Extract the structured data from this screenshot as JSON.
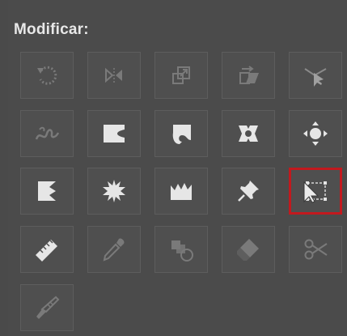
{
  "panel": {
    "title": "Modificar:",
    "selected_tool": "path-selection-tool",
    "accent_color": "#c2191e"
  },
  "tools": [
    {
      "row": 1,
      "col": 1,
      "icon": "rotate-icon"
    },
    {
      "row": 1,
      "col": 2,
      "icon": "reflect-icon"
    },
    {
      "row": 1,
      "col": 3,
      "icon": "scale-icon"
    },
    {
      "row": 1,
      "col": 4,
      "icon": "shear-icon"
    },
    {
      "row": 1,
      "col": 5,
      "icon": "reshape-icon"
    },
    {
      "row": 2,
      "col": 1,
      "icon": "warp-icon"
    },
    {
      "row": 2,
      "col": 2,
      "icon": "pucker-icon"
    },
    {
      "row": 2,
      "col": 3,
      "icon": "twirl-icon"
    },
    {
      "row": 2,
      "col": 4,
      "icon": "scallop-icon"
    },
    {
      "row": 2,
      "col": 5,
      "icon": "bloat-icon"
    },
    {
      "row": 3,
      "col": 1,
      "icon": "crystallize-icon"
    },
    {
      "row": 3,
      "col": 2,
      "icon": "explode-icon"
    },
    {
      "row": 3,
      "col": 3,
      "icon": "wrinkle-icon"
    },
    {
      "row": 3,
      "col": 4,
      "icon": "pin-icon"
    },
    {
      "row": 3,
      "col": 5,
      "icon": "free-transform-icon"
    },
    {
      "row": 4,
      "col": 1,
      "icon": "measure-icon"
    },
    {
      "row": 4,
      "col": 2,
      "icon": "eyedropper-icon"
    },
    {
      "row": 4,
      "col": 3,
      "icon": "blend-icon"
    },
    {
      "row": 4,
      "col": 4,
      "icon": "eraser-icon"
    },
    {
      "row": 4,
      "col": 5,
      "icon": "scissors-icon"
    },
    {
      "row": 5,
      "col": 1,
      "icon": "knife-icon"
    }
  ]
}
